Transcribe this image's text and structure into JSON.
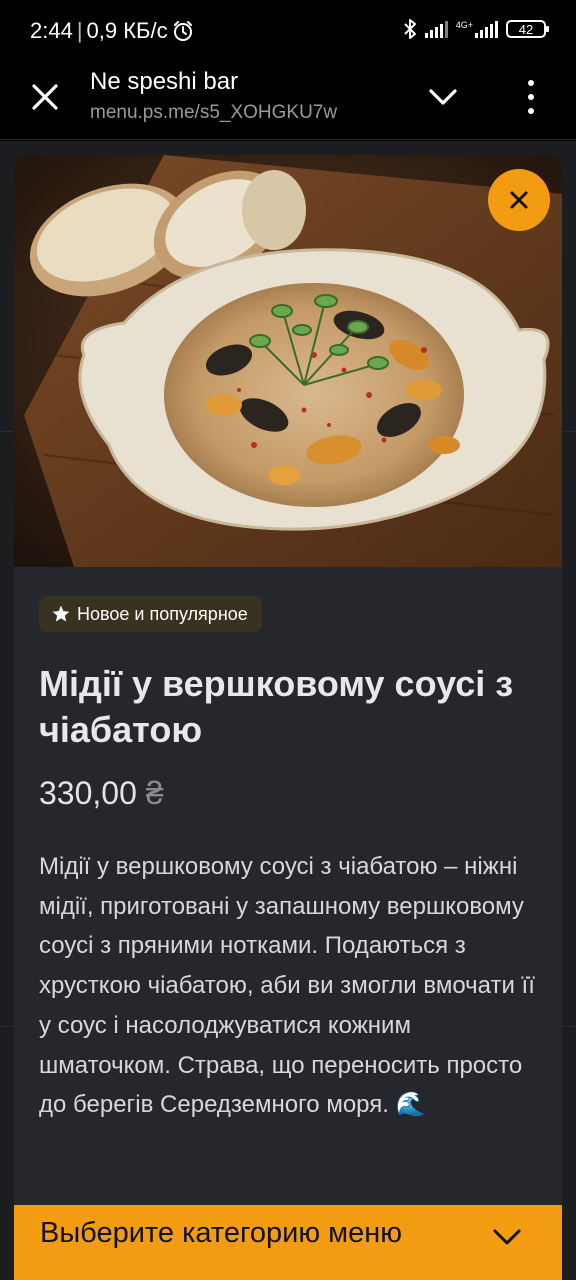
{
  "status_bar": {
    "time": "2:44",
    "network_speed": "0,9 КБ/с",
    "network_type": "4G+",
    "battery": "42"
  },
  "browser": {
    "title": "Ne speshi bar",
    "url": "menu.ps.me/s5_XOHGKU7w"
  },
  "item": {
    "badge": "Новое и популярное",
    "title": "Мідії у вершковому соусі з чіабатою",
    "price": "330,00",
    "currency": "₴",
    "description": "Мідії у вершковому соусі з чіабатою – ніжні мідії, приготовані у запашному вершковому соусі з пряними нотками. Подаються з хрусткою чіабатою, аби ви змогли вмочати її у соус і насолоджуватися кожним шматочком. Страва, що переносить просто до берегів Середземного моря. 🌊"
  },
  "category_bar": {
    "label": "Выберите категорию меню"
  },
  "colors": {
    "accent": "#f39c12",
    "card": "#25272d",
    "badge_bg": "#3a3220"
  },
  "icons": {
    "close": "close-icon",
    "chevron": "chevron-down-icon",
    "menu": "more-vert-icon",
    "star": "star-icon",
    "alarm": "alarm-icon",
    "bluetooth": "bluetooth-icon"
  }
}
